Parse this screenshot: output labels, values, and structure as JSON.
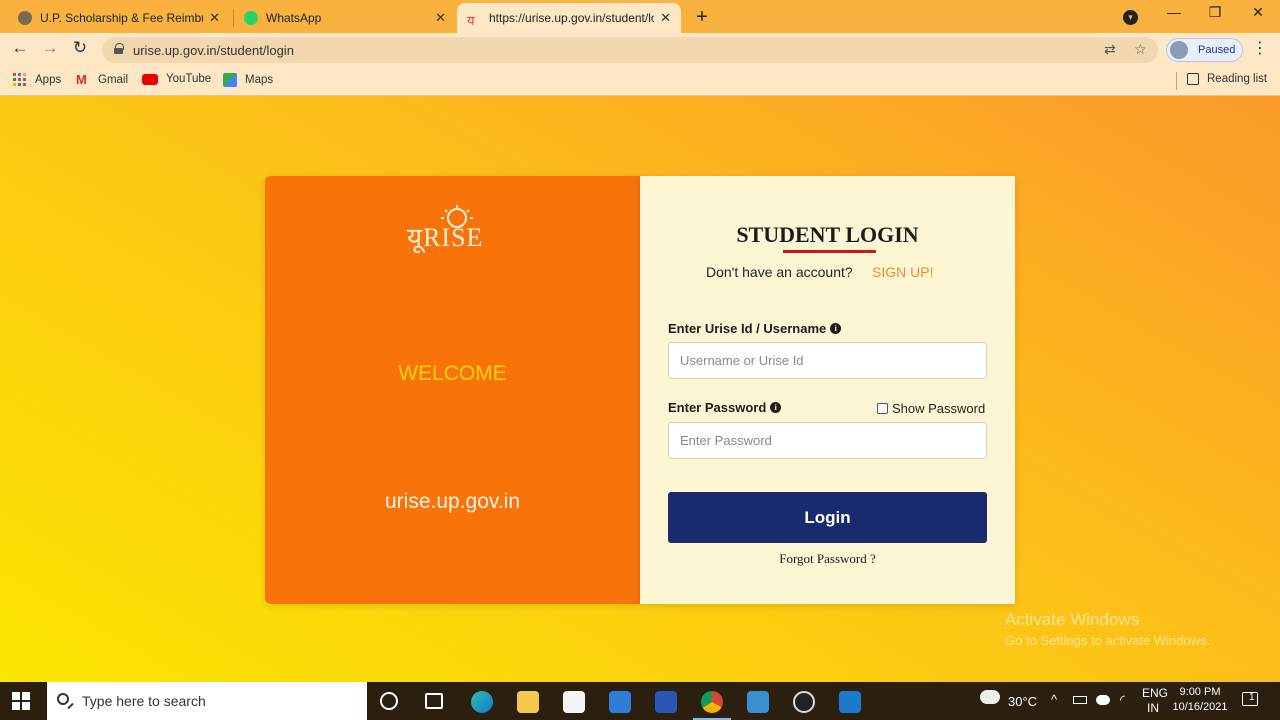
{
  "browser": {
    "tabs": [
      {
        "title": "U.P. Scholarship & Fee Reimbursement",
        "close": "✕",
        "active": false
      },
      {
        "title": "WhatsApp",
        "close": "✕",
        "active": false
      },
      {
        "title": "https://urise.up.gov.in/student/login",
        "close": "✕",
        "active": true
      }
    ],
    "new_tab": "+",
    "window_controls": {
      "profile_menu": "▾",
      "minimize": "—",
      "maximize": "❐",
      "close": "✕"
    },
    "nav": {
      "back": "←",
      "forward": "→",
      "reload": "↻"
    },
    "url": "urise.up.gov.in/student/login",
    "omnibox_icons": {
      "translate": "⇄",
      "bookmark": "☆"
    },
    "profile_status": "Paused",
    "menu": "⋮",
    "bookmarks": [
      {
        "label": "Apps",
        "icon": "apps-grid-icon"
      },
      {
        "label": "Gmail",
        "icon": "gmail-icon"
      },
      {
        "label": "YouTube",
        "icon": "youtube-icon"
      },
      {
        "label": "Maps",
        "icon": "maps-icon"
      }
    ],
    "reading_list": "Reading list"
  },
  "login": {
    "logo_text": "यूRISE",
    "welcome": "WELCOME",
    "site": "urise.up.gov.in",
    "title": "STUDENT LOGIN",
    "account_prompt": "Don't have an account?",
    "signup": "SIGN UP!",
    "username_label": "Enter Urise Id / Username",
    "username_placeholder": "Username or Urise Id",
    "password_label": "Enter Password",
    "password_placeholder": "Enter Password",
    "show_password": "Show Password",
    "info_glyph": "i",
    "login_button": "Login",
    "forgot": "Forgot Password ?"
  },
  "watermark": {
    "line1": "Activate Windows",
    "line2": "Go to Settings to activate Windows."
  },
  "taskbar": {
    "search_placeholder": "Type here to search",
    "weather": "30°C",
    "lang_line1": "ENG",
    "lang_line2": "IN",
    "time": "9:00 PM",
    "date": "10/16/2021",
    "notification_count": "1"
  },
  "colors": {
    "tabbar": "#f9b23f",
    "left_panel": "#f9730b",
    "right_panel": "#fdf6d4",
    "login_button": "#1a2a6e",
    "signup_link": "#f48a2a",
    "title_underline": "#c91a1a"
  }
}
